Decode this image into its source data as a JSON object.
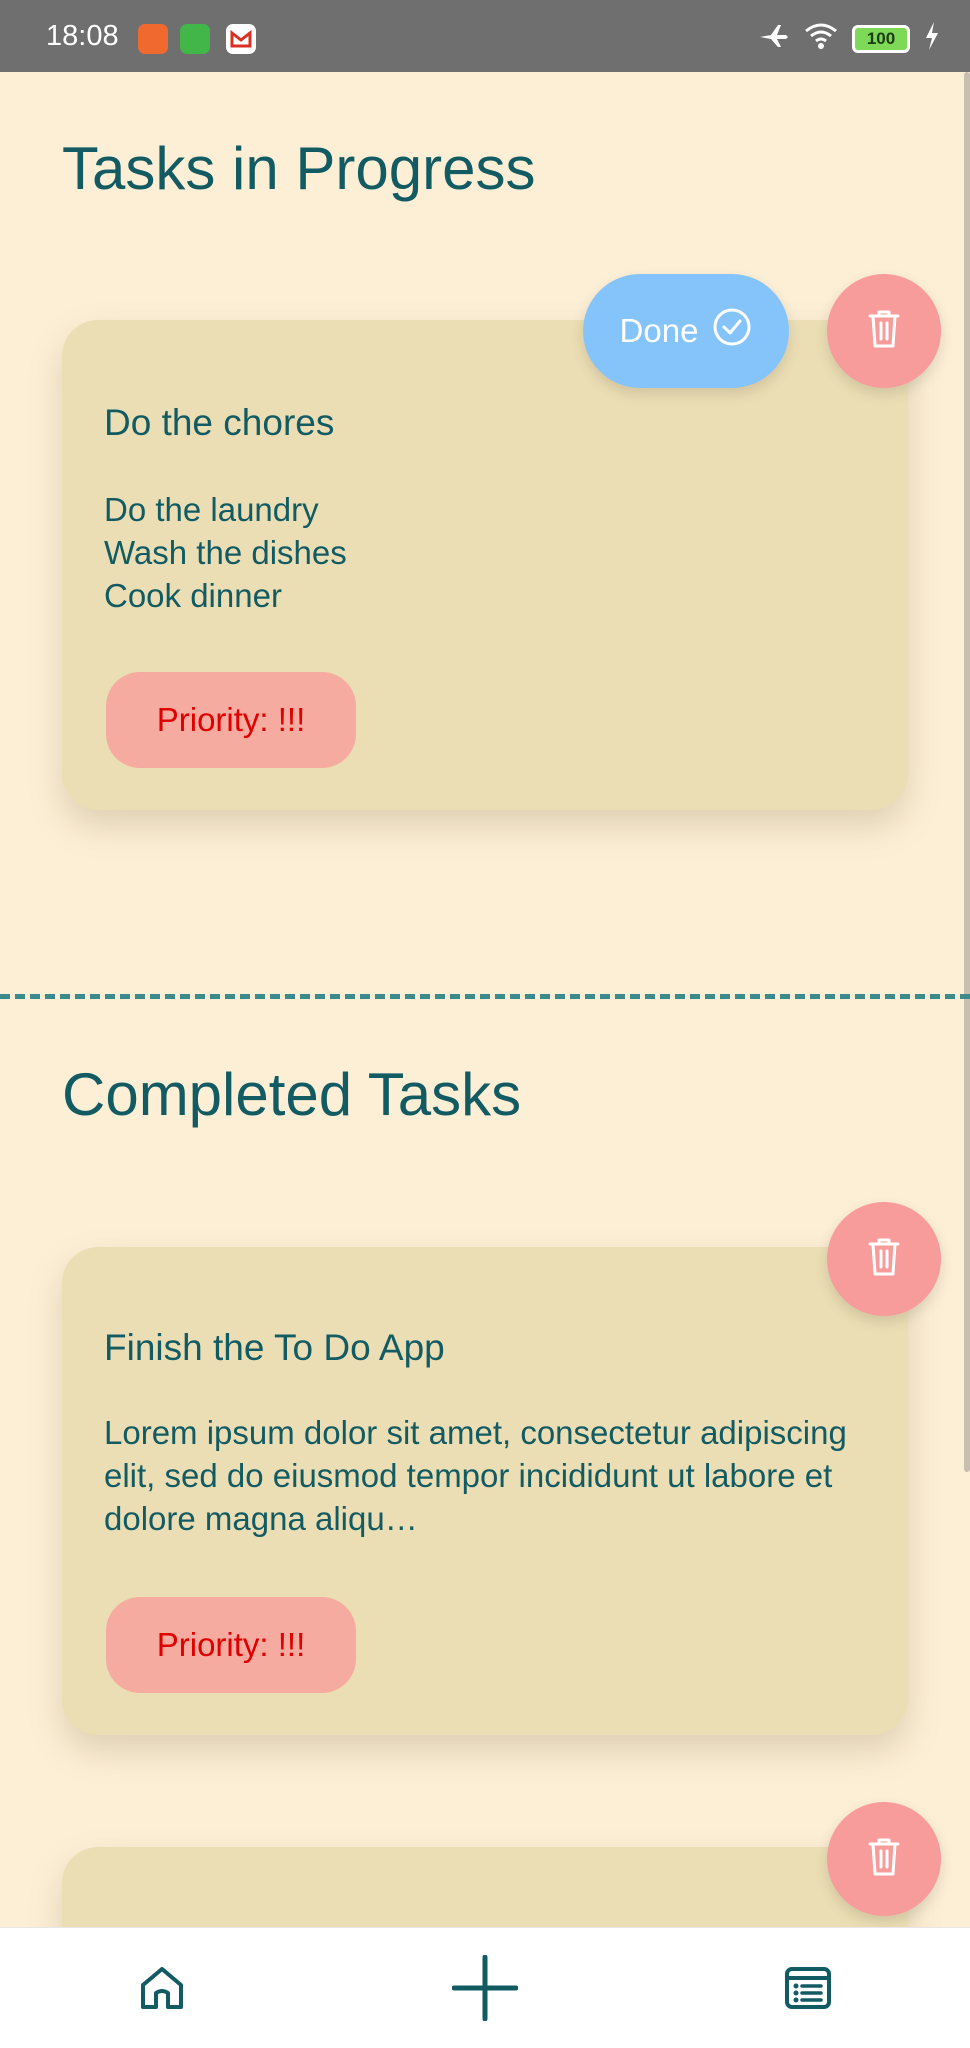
{
  "status_bar": {
    "time": "18:08",
    "battery": "100",
    "icons": [
      "video-app-icon",
      "chat-app-icon",
      "gmail-icon",
      "airplane-icon",
      "wifi-icon",
      "battery-icon",
      "charging-icon"
    ]
  },
  "in_progress": {
    "title": "Tasks in Progress",
    "done_label": "Done",
    "tasks": [
      {
        "title": "Do the chores",
        "body": "Do the laundry\nWash the dishes\nCook dinner",
        "priority": "Priority: !!!"
      }
    ]
  },
  "completed": {
    "title": "Completed Tasks",
    "tasks": [
      {
        "title": "Finish the To Do App",
        "body": "Lorem ipsum dolor sit amet, consectetur adipiscing elit, sed do eiusmod tempor incididunt ut labore et dolore magna aliqu…",
        "priority": "Priority: !!!"
      }
    ]
  },
  "nav": {
    "items": [
      "home-icon",
      "add-icon",
      "list-icon"
    ]
  },
  "colors": {
    "background": "#fdefd6",
    "card": "#ecdeb4",
    "text": "#135b63",
    "priority_bg": "#f6aba0",
    "priority_text": "#e00000",
    "done_button": "#85c4fb",
    "delete_button": "#f79b9b"
  }
}
